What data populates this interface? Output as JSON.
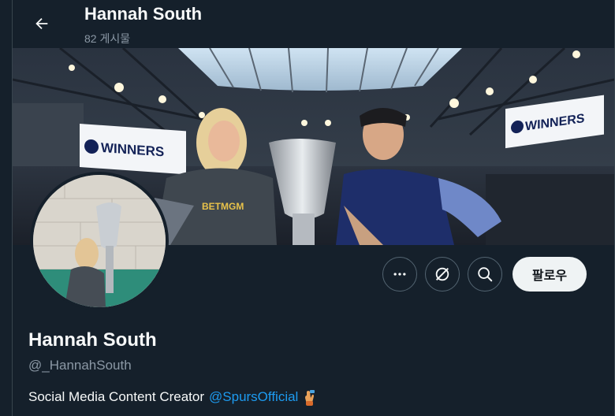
{
  "header": {
    "title": "Hannah South",
    "post_count": "82 게시물"
  },
  "banner": {
    "sign_left": "WINNERS",
    "sign_right": "WINNERS",
    "shirt_text": "BETMGM"
  },
  "actions": {
    "follow_label": "팔로우"
  },
  "profile": {
    "name": "Hannah South",
    "handle": "@_HannahSouth",
    "bio_text": "Social Media Content Creator",
    "bio_link": "@SpursOfficial"
  },
  "icons": [
    "back-arrow-icon",
    "more-icon",
    "subscribe-icon",
    "search-icon",
    "hand-emoji-icon"
  ],
  "colors": {
    "background": "#15202b",
    "link": "#1d9bf0",
    "follow_bg": "#eff3f4",
    "muted": "#8b98a5"
  }
}
